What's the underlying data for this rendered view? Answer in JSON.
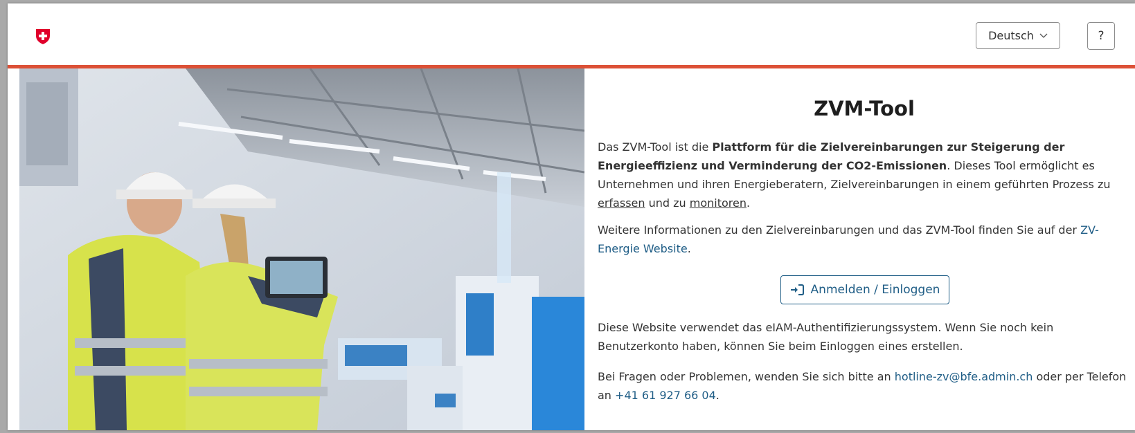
{
  "header": {
    "logo_icon": "swiss-cross-shield-icon",
    "language_label": "Deutsch",
    "language_icon": "chevron-down-icon",
    "help_label": "?"
  },
  "colors": {
    "accent_red": "#dc5036",
    "link_blue": "#1f5d86",
    "swiss_red": "#e0002b"
  },
  "hero": {
    "image_description": "Zwei Personen mit Schutzhelmen und Warnwesten betrachten ein Tablet in einer Industriehalle"
  },
  "main": {
    "title": "ZVM-Tool",
    "intro": {
      "t1": "Das ZVM-Tool ist die ",
      "bold": "Plattform für die Zielvereinbarungen zur Steigerung der Energieeffizienz und Verminderung der CO2-Emissionen",
      "t2": ". Dieses Tool ermöglicht es Unternehmen und ihren Energieberatern, Zielvereinbarungen in einem geführten Prozess zu ",
      "u1": "erfassen",
      "t3": " und zu ",
      "u2": "monitoren",
      "t4": "."
    },
    "info": {
      "t1": "Weitere Informationen zu den Zielvereinbarungen und das ZVM-Tool finden Sie auf der ",
      "link": "ZV-Energie Website",
      "t2": "."
    },
    "login_button": {
      "label": "Anmelden / Einloggen",
      "icon": "sign-in-icon"
    },
    "eiam_text": "Diese Website verwendet das eIAM-Authentifizierungssystem. Wenn Sie noch kein Benutzerkonto haben, können Sie beim Einloggen eines erstellen.",
    "contact": {
      "t1": "Bei Fragen oder Problemen, wenden Sie sich bitte an ",
      "email": "hotline-zv@bfe.admin.ch",
      "t2": " oder per Telefon an ",
      "phone": "+41 61 927 66 04",
      "t3": "."
    }
  }
}
